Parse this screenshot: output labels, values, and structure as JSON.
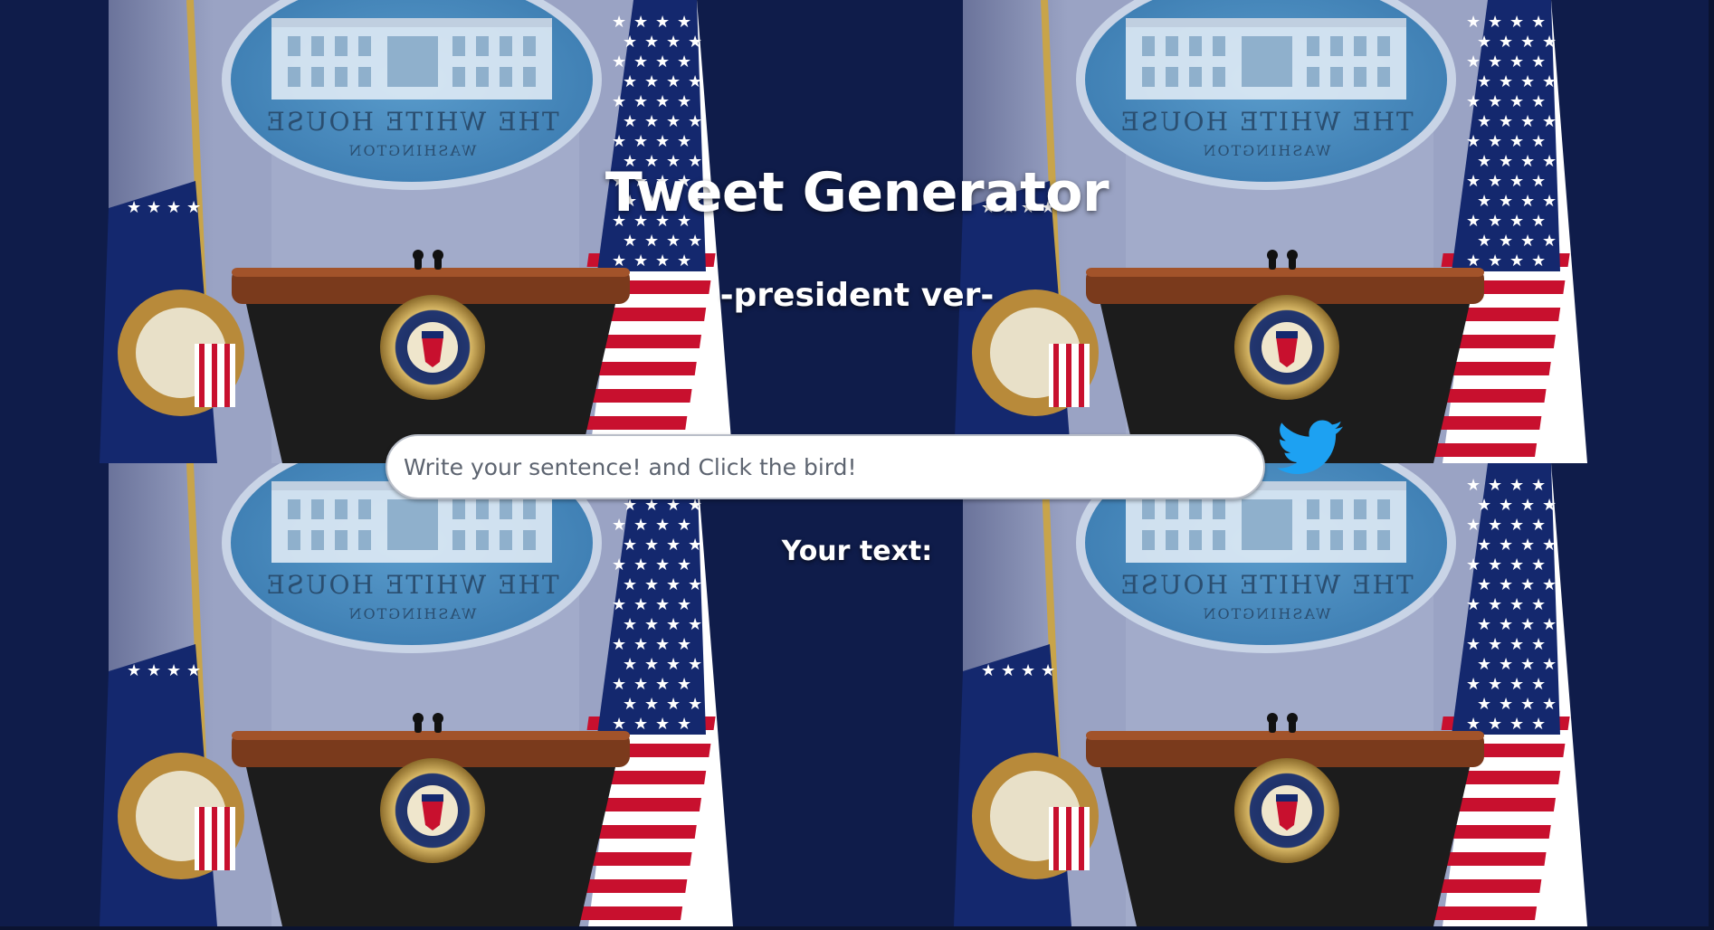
{
  "header": {
    "title": "Tweet Generator",
    "subtitle": "-president ver-"
  },
  "form": {
    "input_value": "",
    "input_placeholder": "Write your sentence! and Click the bird!",
    "submit_icon": "twitter-bird-icon"
  },
  "result": {
    "label": "Your text:",
    "text": ""
  },
  "background": {
    "emblem_text_top": "THE WHITE HOUSE",
    "emblem_text_bottom": "WASHINGTON",
    "colors": {
      "curtain": "#0f1c4a",
      "wall": "#9aa3c4",
      "emblem": "#3b7bb0",
      "podium_wood": "#7a3a1c",
      "podium_face": "#1c1c1c",
      "flag_red": "#c8102e",
      "flag_blue": "#14286e",
      "twitter_blue": "#1da1f2"
    }
  }
}
